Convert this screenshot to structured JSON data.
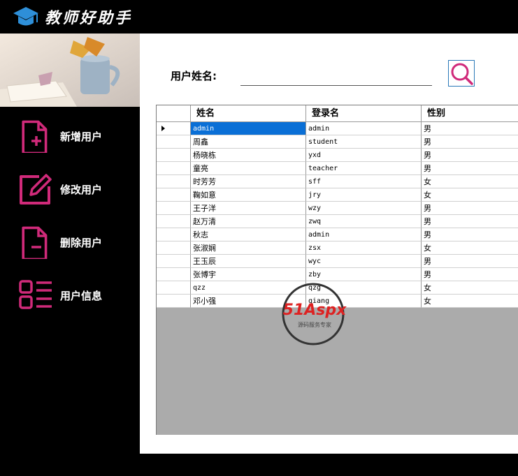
{
  "app": {
    "title": "教师好助手"
  },
  "nav": {
    "items": [
      {
        "label": "新增用户",
        "icon": "file-add-icon"
      },
      {
        "label": "修改用户",
        "icon": "edit-icon"
      },
      {
        "label": "删除用户",
        "icon": "file-remove-icon"
      },
      {
        "label": "用户信息",
        "icon": "list-icon"
      }
    ],
    "accent_color": "#d02a7a"
  },
  "search": {
    "label": "用户姓名:",
    "value": "",
    "icon": "search-icon"
  },
  "grid": {
    "columns": [
      "姓名",
      "登录名",
      "性别"
    ],
    "rows": [
      [
        "admin",
        "admin",
        "男"
      ],
      [
        "周鑫",
        "student",
        "男"
      ],
      [
        "杨晓栋",
        "yxd",
        "男"
      ],
      [
        "童亮",
        "teacher",
        "男"
      ],
      [
        "时芳芳",
        "sff",
        "女"
      ],
      [
        "鞠如意",
        "jry",
        "女"
      ],
      [
        "王子洋",
        "wzy",
        "男"
      ],
      [
        "赵万清",
        "zwq",
        "男"
      ],
      [
        "秋志",
        "admin",
        "男"
      ],
      [
        "张淑娴",
        "zsx",
        "女"
      ],
      [
        "王玉辰",
        "wyc",
        "男"
      ],
      [
        "张博宇",
        "zby",
        "男"
      ],
      [
        "qzz",
        "qzg",
        "女"
      ],
      [
        "邓小强",
        "qiang",
        "女"
      ]
    ],
    "selected_row": 0
  },
  "watermark": {
    "brand": "51Aspx",
    "tagline": "源码服务专家"
  }
}
